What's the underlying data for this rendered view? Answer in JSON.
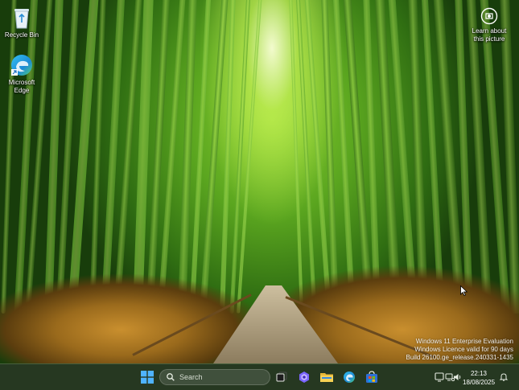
{
  "desktop": {
    "icons": [
      {
        "label": "Recycle Bin",
        "icon": "recycle-bin-icon"
      },
      {
        "label": "Microsoft\nEdge",
        "icon": "edge-icon"
      }
    ],
    "learn_about": {
      "line1": "Learn about",
      "line2": "this picture",
      "icon": "learn-camera-icon"
    }
  },
  "watermark": {
    "line1": "Windows 11 Enterprise Evaluation",
    "line2": "Windows Licence valid for 90 days",
    "line3": "Build 26100.ge_release.240331-1435"
  },
  "taskbar": {
    "search_label": "Search",
    "pinned": [
      "start-icon",
      "task-view-icon",
      "copilot-icon",
      "file-explorer-icon",
      "edge-icon",
      "store-icon"
    ],
    "tray": [
      "widgets-icon",
      "network-icon",
      "volume-icon"
    ],
    "time": "22:13",
    "date": "18/08/2025",
    "notification_icon": "notification-bell-icon"
  },
  "colors": {
    "taskbar_bg": "#263822",
    "accent_blue": "#3a8be0"
  }
}
